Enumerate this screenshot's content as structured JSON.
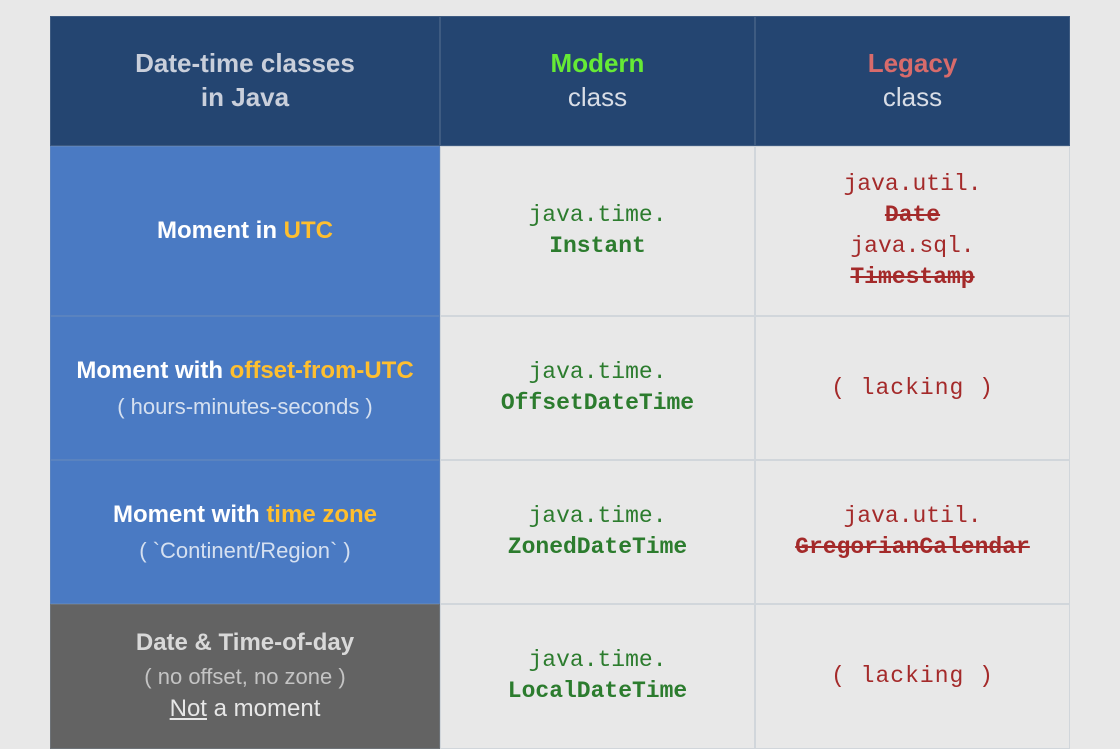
{
  "header": {
    "left_line1": "Date-time classes",
    "left_line2": "in Java",
    "modern": "Modern",
    "legacy": "Legacy",
    "class_word": "class"
  },
  "rows": [
    {
      "label": {
        "prefix": "Moment in ",
        "highlight": "UTC",
        "sub": ""
      },
      "modern": {
        "pkg": "java.time.",
        "cls": "Instant"
      },
      "legacy": {
        "items": [
          {
            "pkg": "java.util.",
            "cls": "Date"
          },
          {
            "pkg": "java.sql.",
            "cls": "Timestamp"
          }
        ]
      }
    },
    {
      "label": {
        "prefix": "Moment with ",
        "highlight": "offset-from-UTC",
        "sub": "( hours-minutes-seconds )"
      },
      "modern": {
        "pkg": "java.time.",
        "cls": "OffsetDateTime"
      },
      "legacy": {
        "lacking": "( lacking )"
      }
    },
    {
      "label": {
        "prefix": "Moment with ",
        "highlight": "time zone",
        "sub": "( `Continent/Region` )"
      },
      "modern": {
        "pkg": "java.time.",
        "cls": "ZonedDateTime"
      },
      "legacy": {
        "items": [
          {
            "pkg": "java.util.",
            "cls": "GregorianCalendar"
          }
        ]
      }
    },
    {
      "label_dark": {
        "main": "Date & Time-of-day",
        "sub": "( no offset, no zone )",
        "not_underline": "Not",
        "not_rest": " a moment"
      },
      "modern": {
        "pkg": "java.time.",
        "cls": "LocalDateTime"
      },
      "legacy": {
        "lacking": "( lacking )"
      }
    }
  ]
}
